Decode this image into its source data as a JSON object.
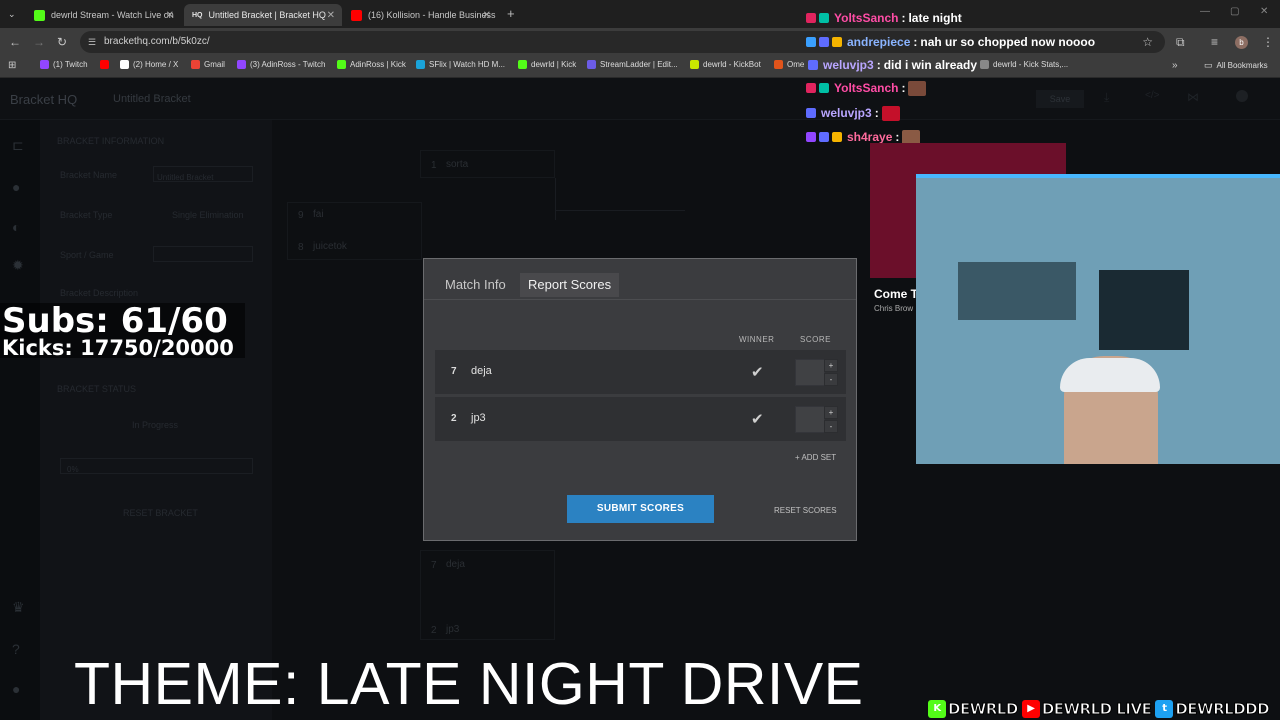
{
  "browser": {
    "tabs": [
      {
        "title": "dewrld Stream - Watch Live on",
        "favicon_color": "#53fc18",
        "active": false
      },
      {
        "title": "Untitled Bracket | Bracket HQ",
        "favicon_text": "HQ",
        "active": true
      },
      {
        "title": "(16) Kollision - Handle Business",
        "favicon_color": "#ff0000",
        "active": false
      }
    ],
    "new_tab": "+",
    "url": "brackethq.com/b/5k0zc/",
    "avatar_letter": "b",
    "bookmarks": [
      {
        "label": "(1) Twitch",
        "color": "#9146ff"
      },
      {
        "label": "",
        "color": "#ff0000"
      },
      {
        "label": "(2) Home / X",
        "color": "#ffffff"
      },
      {
        "label": "Gmail",
        "color": "#ea4335"
      },
      {
        "label": "(3) AdinRoss - Twitch",
        "color": "#9146ff"
      },
      {
        "label": "AdinRoss | Kick",
        "color": "#53fc18"
      },
      {
        "label": "SFlix | Watch HD M...",
        "color": "#1aa3d9"
      },
      {
        "label": "dewrld | Kick",
        "color": "#53fc18"
      },
      {
        "label": "StreamLadder | Edit...",
        "color": "#6c5ce7"
      },
      {
        "label": "dewrld - KickBot",
        "color": "#c8e600"
      },
      {
        "label": "Ome",
        "color": "#e0541b"
      },
      {
        "label": "dewrld - Kick Stats,...",
        "color": "#888888"
      }
    ],
    "all_bookmarks": "All Bookmarks"
  },
  "app": {
    "brand": "Bracket HQ",
    "bracket_title": "Untitled Bracket",
    "save_label": "Save",
    "sidebar": {
      "section_info": "BRACKET INFORMATION",
      "name_label": "Bracket Name",
      "name_value": "Untitled Bracket",
      "type_label": "Bracket Type",
      "type_value": "Single Elimination",
      "sport_label": "Sport / Game",
      "description_label": "Bracket Description",
      "status_section": "BRACKET STATUS",
      "status_value": "In Progress",
      "progress_text": "0%",
      "reset_bracket": "RESET BRACKET"
    },
    "canvas": {
      "entries": [
        {
          "seed": "1",
          "name": "sorta"
        },
        {
          "seed": "9",
          "name": "fai"
        },
        {
          "seed": "8",
          "name": "juicetok"
        },
        {
          "seed": "7",
          "name": "deja"
        },
        {
          "seed": "2",
          "name": "jp3"
        }
      ]
    }
  },
  "modal": {
    "tabs": [
      "Match Info",
      "Report Scores"
    ],
    "active_tab": 1,
    "winner_header": "WINNER",
    "score_header": "SCORE",
    "rows": [
      {
        "seed": "7",
        "name": "deja"
      },
      {
        "seed": "2",
        "name": "jp3"
      }
    ],
    "stepper_plus": "+",
    "stepper_minus": "-",
    "add_set": "+ ADD SET",
    "submit": "SUBMIT SCORES",
    "reset": "RESET SCORES"
  },
  "overlay": {
    "subs": "Subs: 61/60",
    "kicks": "Kicks: 17750/20000",
    "theme": "THEME: LATE NIGHT DRIVE",
    "chat": [
      {
        "user": "YoltsSanch",
        "color": "#ff4da6",
        "message": "late night",
        "badges": [
          "#e0245e",
          "#00bfa5"
        ]
      },
      {
        "user": "andrepiece",
        "color": "#8ab4ff",
        "message": "nah ur so chopped now noooo",
        "badges": [
          "#3aa0ff",
          "#5f6cff",
          "#f5b400"
        ]
      },
      {
        "user": "weluvjp3",
        "color": "#b9a6ff",
        "message": "did i win already",
        "badges": [
          "#5f6cff"
        ]
      },
      {
        "user": "YoltsSanch",
        "color": "#ff4da6",
        "message": "",
        "badges": [
          "#e0245e",
          "#00bfa5"
        ],
        "emote_color": "#7a4a3a"
      },
      {
        "user": "weluvjp3",
        "color": "#b9a6ff",
        "message": "",
        "badges": [
          "#5f6cff"
        ],
        "emote_color": "#c4102a"
      },
      {
        "user": "sh4raye",
        "color": "#ff6b9d",
        "message": "",
        "badges": [
          "#9146ff",
          "#5f6cff",
          "#f5b400"
        ],
        "emote_color": "#8a5a44"
      }
    ],
    "thumbnail": {
      "title": "Come T",
      "subtitle": "Chris Brow"
    },
    "socials": [
      {
        "label": "DEWRLD",
        "icon": "K",
        "color": "#53fc18"
      },
      {
        "label": "DEWRLD LIVE",
        "icon": "▶",
        "color": "#ff0000"
      },
      {
        "label": "DEWRLDDD",
        "icon": "t",
        "color": "#1da1f2"
      }
    ]
  }
}
